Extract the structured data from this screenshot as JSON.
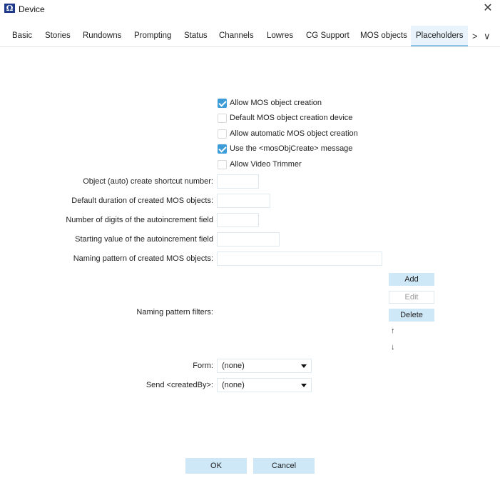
{
  "window": {
    "icon_glyph": "Ω",
    "title": "Device",
    "close_glyph": "✕"
  },
  "tabs": [
    {
      "label": "Basic"
    },
    {
      "label": "Stories"
    },
    {
      "label": "Rundowns"
    },
    {
      "label": "Prompting"
    },
    {
      "label": "Status"
    },
    {
      "label": "Channels"
    },
    {
      "label": "Lowres"
    },
    {
      "label": "CG Support"
    },
    {
      "label": "MOS objects"
    },
    {
      "label": "Placeholders",
      "active": true
    }
  ],
  "tab_nav": {
    "next_glyph": ">",
    "more_glyph": "∨"
  },
  "checkboxes": [
    {
      "label": "Allow MOS object creation",
      "checked": true
    },
    {
      "label": "Default MOS object creation device",
      "checked": false
    },
    {
      "label": "Allow automatic MOS object creation",
      "checked": false
    },
    {
      "label": "Use the <mosObjCreate> message",
      "checked": true
    },
    {
      "label": "Allow Video Trimmer",
      "checked": false
    }
  ],
  "fields": [
    {
      "label": "Object (auto) create shortcut number:",
      "value": ""
    },
    {
      "label": "Default duration of created MOS objects:",
      "value": ""
    },
    {
      "label": "Number of digits of the autoincrement field",
      "value": ""
    },
    {
      "label": "Starting value of the autoincrement field",
      "value": ""
    },
    {
      "label": "Naming pattern of created MOS objects:",
      "value": ""
    }
  ],
  "filters": {
    "label": "Naming pattern filters:",
    "add_label": "Add",
    "edit_label": "Edit",
    "delete_label": "Delete",
    "up_glyph": "↑",
    "down_glyph": "↓"
  },
  "selects": [
    {
      "label": "Form:",
      "value": "(none)"
    },
    {
      "label": "Send <createdBy>:",
      "value": "(none)"
    }
  ],
  "footer": {
    "ok_label": "OK",
    "cancel_label": "Cancel"
  },
  "colors": {
    "accent": "#3d9bd8",
    "button_bg": "#cfe8f8",
    "active_tab_bg": "#e8f3fb"
  }
}
